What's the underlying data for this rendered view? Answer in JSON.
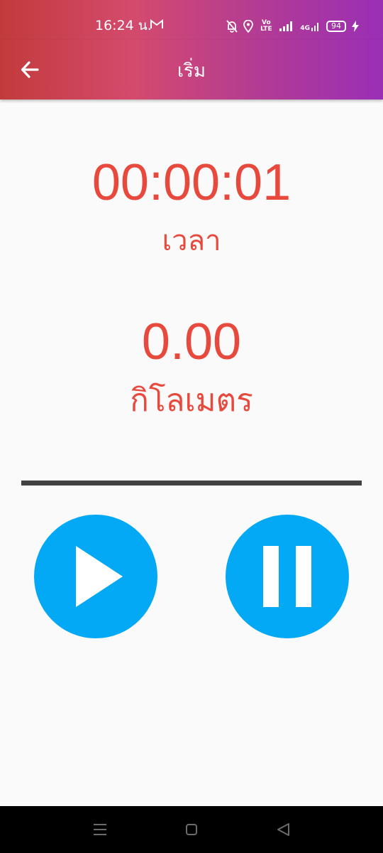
{
  "status_bar": {
    "time": "16:24 น.",
    "carrier_icon": "gmail-icon",
    "battery_level": "94",
    "network_label": "4G",
    "volte_label": "Vo LTE"
  },
  "app_bar": {
    "title": "เริ่ม",
    "back_icon": "arrow-back-icon"
  },
  "main": {
    "timer_value": "00:00:01",
    "timer_label": "เวลา",
    "distance_value": "0.00",
    "distance_label": "กิโลเมตร"
  },
  "controls": {
    "play_icon": "play-icon",
    "pause_icon": "pause-icon",
    "button_color": "#03a9f4"
  },
  "colors": {
    "accent_red": "#e8493d",
    "divider": "#424242",
    "background": "#fafafa"
  }
}
